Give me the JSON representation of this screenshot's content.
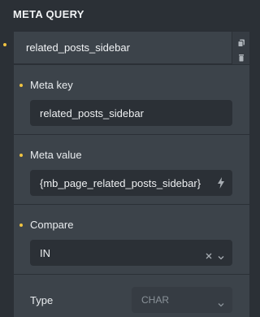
{
  "section": {
    "title": "META QUERY"
  },
  "item": {
    "title": "related_posts_sidebar",
    "actions": {
      "duplicate_icon": "copy-icon",
      "delete_icon": "trash-icon"
    }
  },
  "fields": {
    "meta_key": {
      "label": "Meta key",
      "value": "related_posts_sidebar"
    },
    "meta_value": {
      "label": "Meta value",
      "value": "{mb_page_related_posts_sidebar}",
      "icon": "lightning-icon"
    },
    "compare": {
      "label": "Compare",
      "value": "IN",
      "clear_icon": "close-icon",
      "dropdown_icon": "chevron-down-icon"
    },
    "type": {
      "label": "Type",
      "value": "CHAR",
      "dropdown_icon": "chevron-down-icon"
    }
  },
  "colors": {
    "background": "#2b3036",
    "panel": "#3c434a",
    "input": "#2b3036",
    "accent_dot": "#f0c341",
    "text": "#e6e8ea",
    "muted": "#8a9299"
  }
}
